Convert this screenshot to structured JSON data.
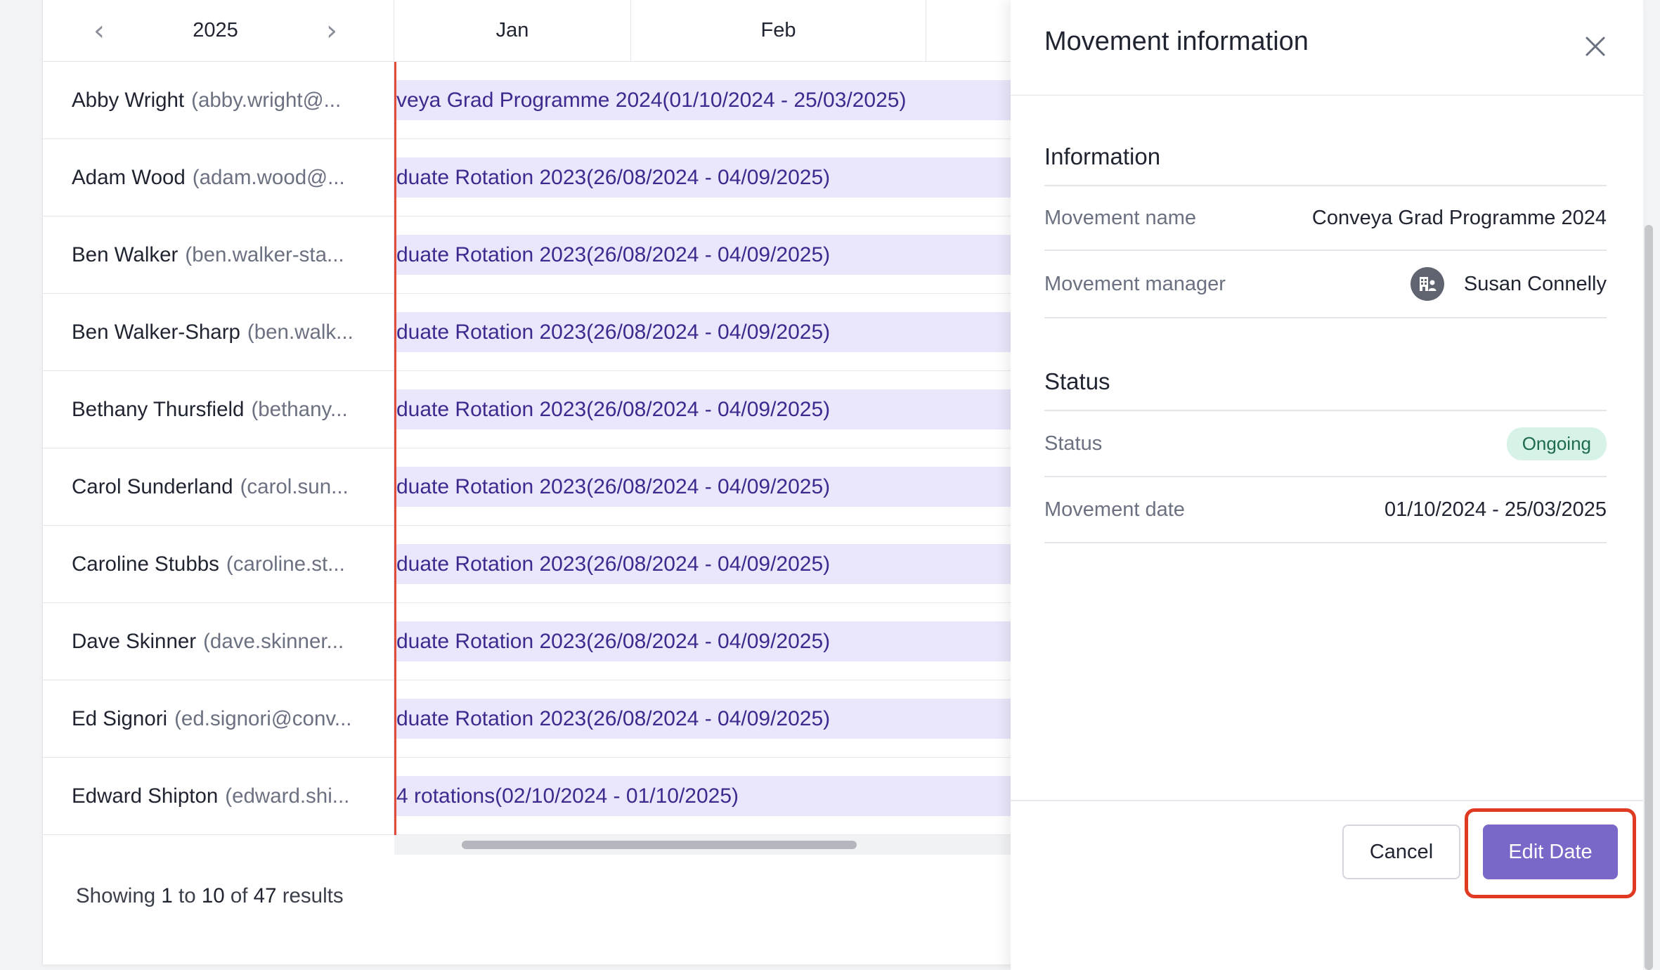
{
  "timeline": {
    "year": "2025",
    "prev_icon": "chevron-left-icon",
    "next_icon": "chevron-right-icon",
    "months": [
      "Jan",
      "Feb"
    ],
    "rows": [
      {
        "name": "Abby Wright",
        "email": "(abby.wright@...",
        "bar": "veya Grad Programme 2024(01/10/2024 - 25/03/2025)"
      },
      {
        "name": "Adam Wood",
        "email": "(adam.wood@...",
        "bar": "duate Rotation 2023(26/08/2024 - 04/09/2025)"
      },
      {
        "name": "Ben Walker",
        "email": "(ben.walker-sta...",
        "bar": "duate Rotation 2023(26/08/2024 - 04/09/2025)"
      },
      {
        "name": "Ben Walker-Sharp",
        "email": "(ben.walk...",
        "bar": "duate Rotation 2023(26/08/2024 - 04/09/2025)"
      },
      {
        "name": "Bethany Thursfield",
        "email": "(bethany...",
        "bar": "duate Rotation 2023(26/08/2024 - 04/09/2025)"
      },
      {
        "name": "Carol Sunderland",
        "email": "(carol.sun...",
        "bar": "duate Rotation 2023(26/08/2024 - 04/09/2025)"
      },
      {
        "name": "Caroline Stubbs",
        "email": "(caroline.st...",
        "bar": "duate Rotation 2023(26/08/2024 - 04/09/2025)"
      },
      {
        "name": "Dave Skinner",
        "email": "(dave.skinner...",
        "bar": "duate Rotation 2023(26/08/2024 - 04/09/2025)"
      },
      {
        "name": "Ed Signori",
        "email": "(ed.signori@conv...",
        "bar": "duate Rotation 2023(26/08/2024 - 04/09/2025)"
      },
      {
        "name": "Edward Shipton",
        "email": "(edward.shi...",
        "bar": "4 rotations(02/10/2024 - 01/10/2025)"
      }
    ]
  },
  "pagination": {
    "prefix": "Showing",
    "from": "1",
    "to_word": "to",
    "to": "10",
    "of_word": "of",
    "total": "47",
    "suffix": "results"
  },
  "panel": {
    "title": "Movement information",
    "close_icon": "close-icon",
    "information": {
      "heading": "Information",
      "movement_name_label": "Movement name",
      "movement_name_value": "Conveya Grad Programme 2024",
      "movement_manager_label": "Movement manager",
      "movement_manager_value": "Susan Connelly",
      "manager_icon": "building-user-icon"
    },
    "status": {
      "heading": "Status",
      "status_label": "Status",
      "status_value": "Ongoing",
      "date_label": "Movement date",
      "date_value": "01/10/2024 - 25/03/2025"
    },
    "cancel_label": "Cancel",
    "edit_label": "Edit Date"
  },
  "colors": {
    "accent": "#7a67c8",
    "bar_fill": "#eae6fb",
    "bar_text": "#3e2a8e",
    "today_line": "#e24a3a",
    "badge_bg": "#d7f2e6",
    "badge_text": "#1f6b4d",
    "highlight": "#e03a22"
  }
}
